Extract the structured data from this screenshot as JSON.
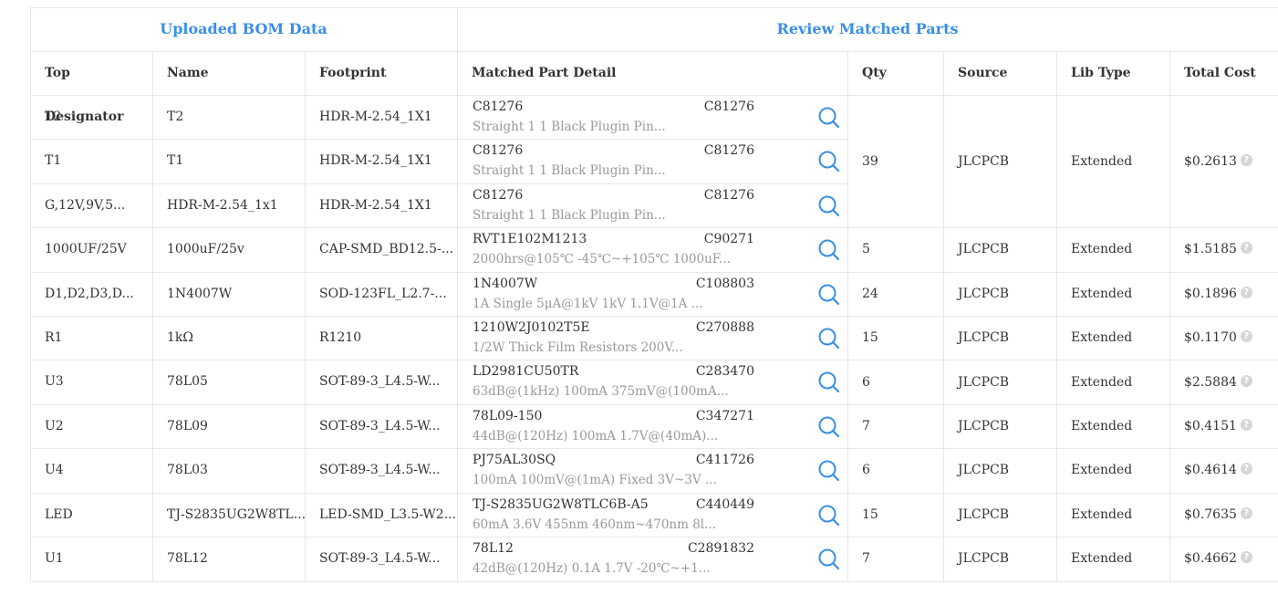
{
  "groups": {
    "uploaded": "Uploaded BOM Data",
    "review": "Review Matched Parts"
  },
  "headers": {
    "designator": "Top Designator",
    "name": "Name",
    "footprint": "Footprint",
    "matched": "Matched Part Detail",
    "qty": "Qty",
    "source": "Source",
    "lib_type": "Lib Type",
    "total_cost": "Total Cost"
  },
  "rows": [
    {
      "designator": "T2",
      "name": "T2",
      "footprint": "HDR-M-2.54_1X1",
      "part": "C81276",
      "code": "C81276",
      "desc": "Straight 1 1 Black Plugin Pin..."
    },
    {
      "designator": "T1",
      "name": "T1",
      "footprint": "HDR-M-2.54_1X1",
      "part": "C81276",
      "code": "C81276",
      "desc": "Straight 1 1 Black Plugin Pin..."
    },
    {
      "designator": "G,12V,9V,5...",
      "name": "HDR-M-2.54_1x1",
      "footprint": "HDR-M-2.54_1X1",
      "part": "C81276",
      "code": "C81276",
      "desc": "Straight 1 1 Black Plugin Pin..."
    },
    {
      "designator": "1000UF/25V",
      "name": "1000uF/25v",
      "footprint": "CAP-SMD_BD12.5-...",
      "part": "RVT1E102M1213",
      "code": "C90271",
      "desc": "2000hrs@105℃ -45℃~+105℃ 1000uF..."
    },
    {
      "designator": "D1,D2,D3,D...",
      "name": "1N4007W",
      "footprint": "SOD-123FL_L2.7-...",
      "part": "1N4007W",
      "code": "C108803",
      "desc": "1A Single 5μA@1kV 1kV 1.1V@1A ..."
    },
    {
      "designator": "R1",
      "name": "1kΩ",
      "footprint": "R1210",
      "part": "1210W2J0102T5E",
      "code": "C270888",
      "desc": "1/2W Thick Film Resistors 200V..."
    },
    {
      "designator": "U3",
      "name": "78L05",
      "footprint": "SOT-89-3_L4.5-W...",
      "part": "LD2981CU50TR",
      "code": "C283470",
      "desc": "63dB@(1kHz) 100mA 375mV@(100mA..."
    },
    {
      "designator": "U2",
      "name": "78L09",
      "footprint": "SOT-89-3_L4.5-W...",
      "part": "78L09-150",
      "code": "C347271",
      "desc": "44dB@(120Hz) 100mA 1.7V@(40mA)..."
    },
    {
      "designator": "U4",
      "name": "78L03",
      "footprint": "SOT-89-3_L4.5-W...",
      "part": "PJ75AL30SQ",
      "code": "C411726",
      "desc": "100mA 100mV@(1mA) Fixed 3V~3V ..."
    },
    {
      "designator": "LED",
      "name": "TJ-S2835UG2W8TL...",
      "footprint": "LED-SMD_L3.5-W2...",
      "part": "TJ-S2835UG2W8TLC6B-A5",
      "code": "C440449",
      "desc": "60mA 3.6V 455nm 460nm~470nm 8l..."
    },
    {
      "designator": "U1",
      "name": "78L12",
      "footprint": "SOT-89-3_L4.5-W...",
      "part": "78L12",
      "code": "C2891832",
      "desc": "42dB@(120Hz) 0.1A 1.7V -20℃~+1..."
    }
  ],
  "groups_right": [
    {
      "qty": "39",
      "source": "JLCPCB",
      "lib": "Extended",
      "cost": "$0.2613"
    },
    {
      "qty": "5",
      "source": "JLCPCB",
      "lib": "Extended",
      "cost": "$1.5185"
    },
    {
      "qty": "24",
      "source": "JLCPCB",
      "lib": "Extended",
      "cost": "$0.1896"
    },
    {
      "qty": "15",
      "source": "JLCPCB",
      "lib": "Extended",
      "cost": "$0.1170"
    },
    {
      "qty": "6",
      "source": "JLCPCB",
      "lib": "Extended",
      "cost": "$2.5884"
    },
    {
      "qty": "7",
      "source": "JLCPCB",
      "lib": "Extended",
      "cost": "$0.4151"
    },
    {
      "qty": "6",
      "source": "JLCPCB",
      "lib": "Extended",
      "cost": "$0.4614"
    },
    {
      "qty": "15",
      "source": "JLCPCB",
      "lib": "Extended",
      "cost": "$0.7635"
    },
    {
      "qty": "7",
      "source": "JLCPCB",
      "lib": "Extended",
      "cost": "$0.4662"
    }
  ],
  "colors": {
    "accent": "#3a8ee6",
    "muted": "#999999",
    "border": "#e6e6e6"
  },
  "icons": {
    "search": "search-icon",
    "help": "question-icon"
  }
}
